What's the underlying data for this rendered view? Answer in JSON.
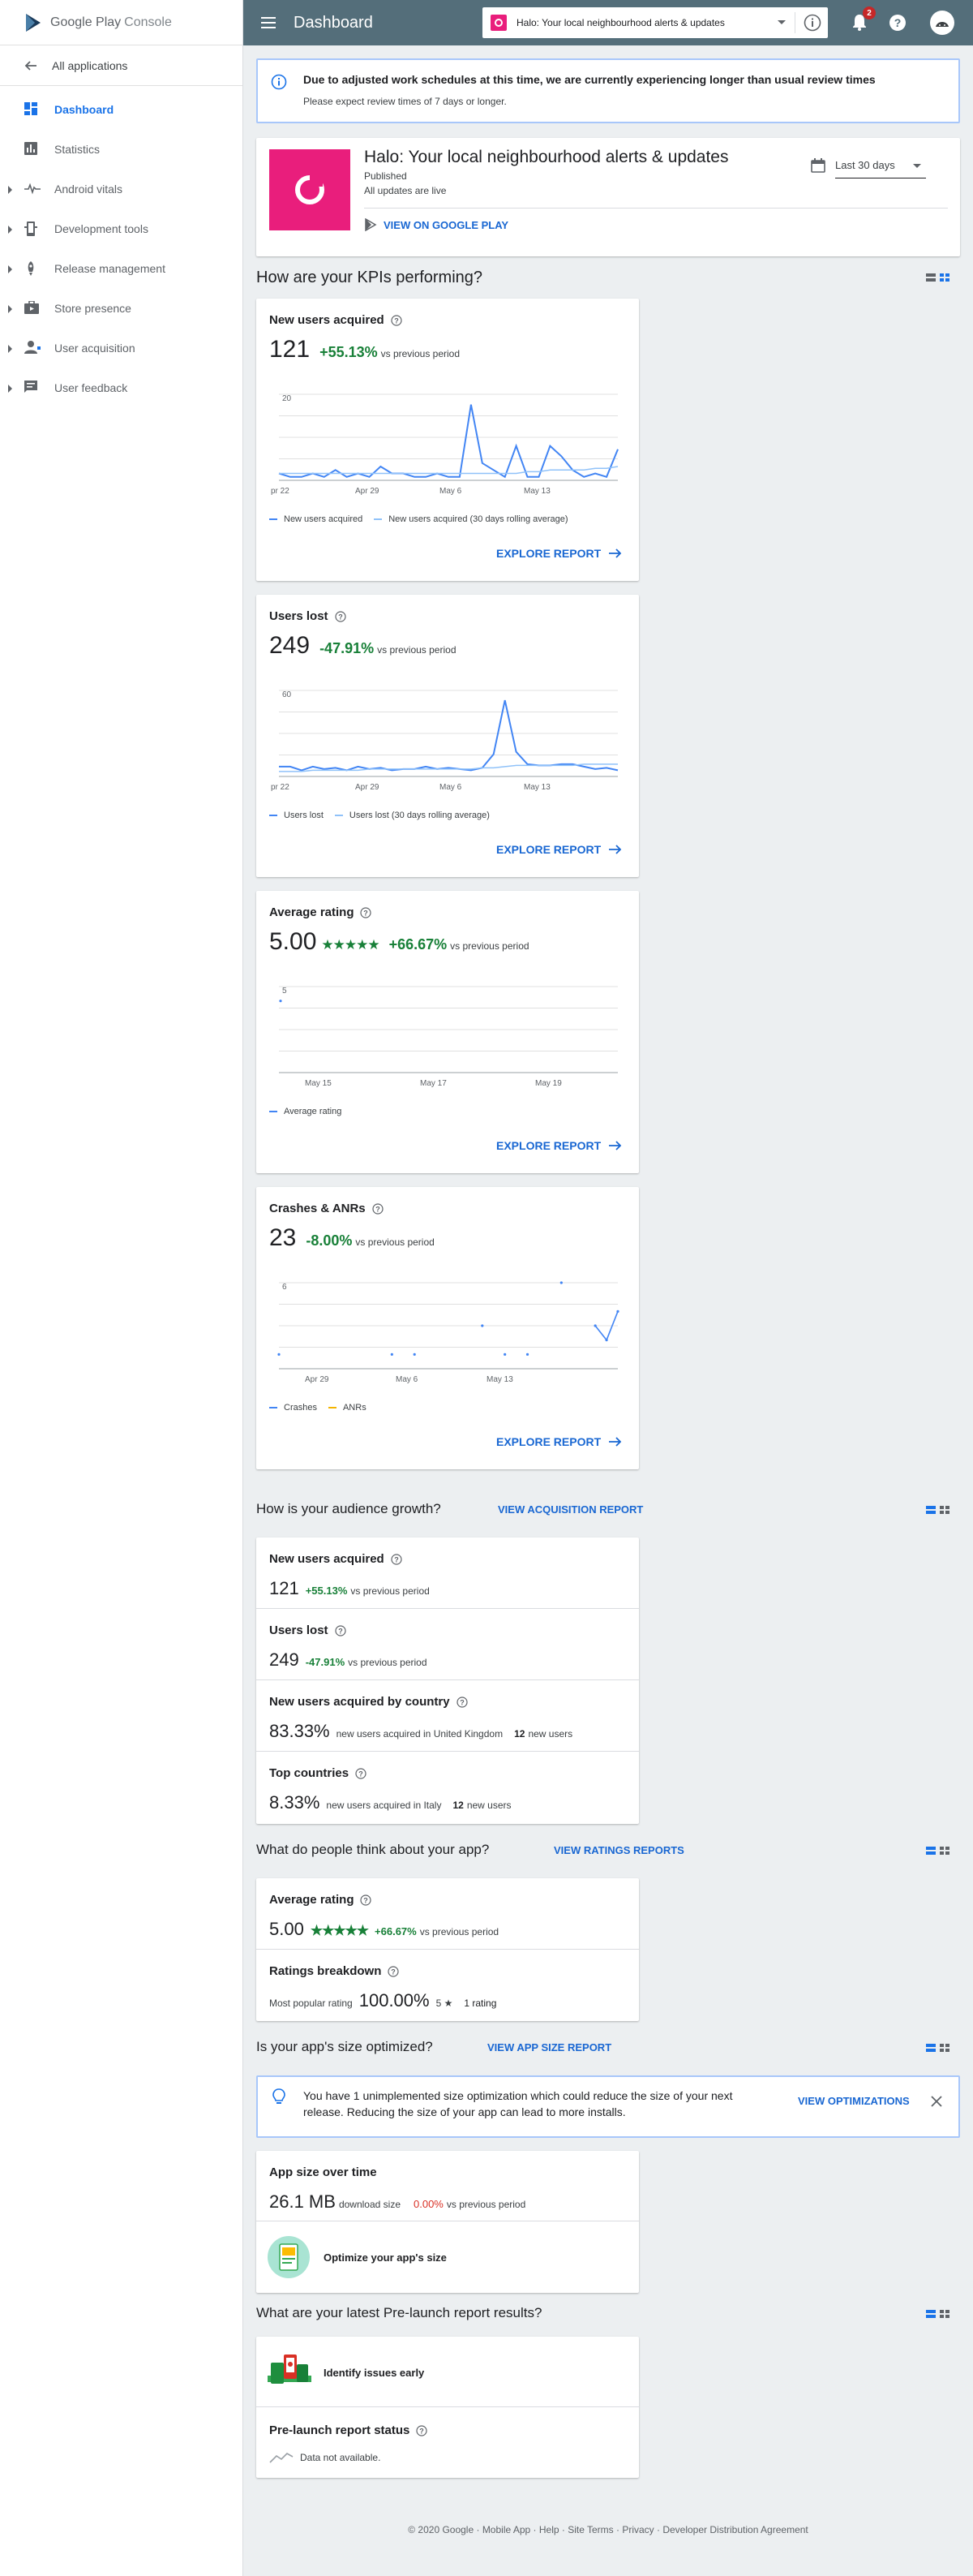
{
  "sidebar": {
    "logo_google": "Google Play",
    "logo_console": "Console",
    "back_label": "All applications",
    "items": [
      {
        "label": "Dashboard",
        "icon": "dashboard-icon",
        "active": true
      },
      {
        "label": "Statistics",
        "icon": "bar-chart-icon"
      },
      {
        "label": "Android vitals",
        "icon": "pulse-icon"
      },
      {
        "label": "Development tools",
        "icon": "device-icon"
      },
      {
        "label": "Release management",
        "icon": "rocket-icon"
      },
      {
        "label": "Store presence",
        "icon": "briefcase-icon"
      },
      {
        "label": "User acquisition",
        "icon": "person-add-icon"
      },
      {
        "label": "User feedback",
        "icon": "feedback-icon"
      }
    ]
  },
  "topbar": {
    "title": "Dashboard",
    "app_selector": "Halo: Your local neighbourhood alerts & updates",
    "notification_count": "2"
  },
  "notice": {
    "line1": "Due to adjusted work schedules at this time, we are currently experiencing longer than usual review times",
    "line2": "Please expect review times of 7 days or longer."
  },
  "app": {
    "name": "Halo: Your local neighbourhood alerts & updates",
    "status": "Published",
    "updates": "All updates are live",
    "view_link": "VIEW ON GOOGLE PLAY",
    "date_range": "Last 30 days"
  },
  "kpi_section": {
    "heading": "How are your KPIs performing?",
    "explore_label": "EXPLORE REPORT",
    "cards": [
      {
        "title": "New users acquired",
        "value": "121",
        "change": "+55.13%",
        "vs": "vs previous period"
      },
      {
        "title": "Users lost",
        "value": "249",
        "change": "-47.91%",
        "vs": "vs previous period"
      },
      {
        "title": "Average rating",
        "value": "5.00",
        "stars": "★★★★★",
        "change": "+66.67%",
        "vs": "vs previous period"
      },
      {
        "title": "Crashes & ANRs",
        "value": "23",
        "change": "-8.00%",
        "vs": "vs previous period"
      }
    ]
  },
  "chart_data": [
    {
      "type": "line",
      "y_tick": "20",
      "x_ticks": [
        "pr 22",
        "Apr 29",
        "May 6",
        "May 13"
      ],
      "ylim": [
        0,
        25
      ],
      "series": [
        {
          "name": "New users acquired",
          "color": "#4285f4",
          "values": [
            2,
            1,
            1,
            2,
            1,
            3,
            1,
            2,
            1,
            4,
            2,
            2,
            1,
            1,
            2,
            1,
            1,
            22,
            5,
            3,
            1,
            10,
            1,
            1,
            10,
            7,
            3,
            1,
            2,
            1,
            9
          ]
        },
        {
          "name": "New users acquired (30 days rolling average)",
          "color": "#90c2f9",
          "values": [
            2,
            2,
            2,
            2,
            2,
            2,
            2,
            2,
            2,
            2,
            2,
            2,
            2,
            2,
            2,
            2,
            2,
            2,
            2,
            2,
            2,
            2,
            2.5,
            2.5,
            3,
            3,
            3,
            3,
            3.5,
            3.5,
            4
          ]
        }
      ]
    },
    {
      "type": "line",
      "y_tick": "60",
      "x_ticks": [
        "pr 22",
        "Apr 29",
        "May 6",
        "May 13"
      ],
      "ylim": [
        0,
        70
      ],
      "series": [
        {
          "name": "Users lost",
          "color": "#4285f4",
          "values": [
            8,
            8,
            5,
            8,
            6,
            7,
            5,
            8,
            6,
            7,
            5,
            6,
            6,
            8,
            6,
            7,
            6,
            5,
            7,
            18,
            62,
            20,
            10,
            9,
            9,
            10,
            10,
            8,
            6,
            7,
            5
          ]
        },
        {
          "name": "Users lost (30 days rolling average)",
          "color": "#90c2f9",
          "values": [
            4,
            4,
            4,
            5,
            5,
            5,
            5,
            5,
            6,
            6,
            6,
            6,
            6,
            6,
            6,
            6,
            6,
            6,
            7,
            7,
            8,
            9,
            9,
            9,
            9,
            9,
            9,
            10,
            10,
            10,
            10
          ]
        }
      ]
    },
    {
      "type": "line",
      "y_tick": "5",
      "x_ticks": [
        "May 15",
        "May 17",
        "May 19"
      ],
      "ylim": [
        0,
        6
      ],
      "series": [
        {
          "name": "Average rating",
          "color": "#4285f4",
          "values": [
            5
          ]
        }
      ]
    },
    {
      "type": "scatter",
      "y_tick": "6",
      "x_ticks": [
        "Apr 29",
        "May 6",
        "May 13"
      ],
      "ylim": [
        0,
        6
      ],
      "series": [
        {
          "name": "Crashes",
          "color": "#4285f4",
          "values": [
            1,
            null,
            null,
            null,
            null,
            null,
            null,
            null,
            null,
            null,
            1,
            null,
            1,
            null,
            null,
            null,
            null,
            null,
            3,
            null,
            1,
            null,
            1,
            null,
            null,
            6,
            null,
            null,
            3,
            2,
            4
          ]
        },
        {
          "name": "ANRs",
          "color": "#f4b400",
          "values": []
        }
      ]
    }
  ],
  "audience": {
    "heading": "How is your audience growth?",
    "link": "VIEW ACQUISITION REPORT",
    "rows": [
      {
        "title": "New users acquired",
        "value": "121",
        "change": "+55.13%",
        "suffix": "vs previous period"
      },
      {
        "title": "Users lost",
        "value": "249",
        "change": "-47.91%",
        "suffix": "vs previous period"
      },
      {
        "title": "New users acquired by country",
        "value": "83.33%",
        "suffix": "new users acquired in United Kingdom",
        "count": "12",
        "count_label": "new users"
      },
      {
        "title": "Top countries",
        "value": "8.33%",
        "suffix": "new users acquired in Italy",
        "count": "12",
        "count_label": "new users"
      }
    ]
  },
  "ratings": {
    "heading": "What do people think about your app?",
    "link": "VIEW RATINGS REPORTS",
    "avg_title": "Average rating",
    "avg_value": "5.00",
    "stars": "★★★★★",
    "change": "+66.67%",
    "vs": "vs previous period",
    "breakdown_title": "Ratings breakdown",
    "most_popular_label": "Most popular rating",
    "most_popular_value": "100.00%",
    "star_label": "5 ★",
    "count": "1 rating"
  },
  "size": {
    "heading": "Is your app's size optimized?",
    "link": "VIEW APP SIZE REPORT",
    "tip": "You have 1 unimplemented size optimization which could reduce the size of your next release. Reducing the size of your app can lead to more installs.",
    "tip_link": "VIEW OPTIMIZATIONS",
    "over_time_title": "App size over time",
    "value": "26.1 MB",
    "value_label": "download size",
    "change": "0.00%",
    "vs": "vs previous period",
    "optimize_label": "Optimize your app's size"
  },
  "prelaunch": {
    "heading": "What are your latest Pre-launch report results?",
    "identify_label": "Identify issues early",
    "status_title": "Pre-launch report status",
    "status_text": "Data not available."
  },
  "footer": "© 2020 Google · Mobile App · Help · Site Terms · Privacy · Developer Distribution Agreement"
}
